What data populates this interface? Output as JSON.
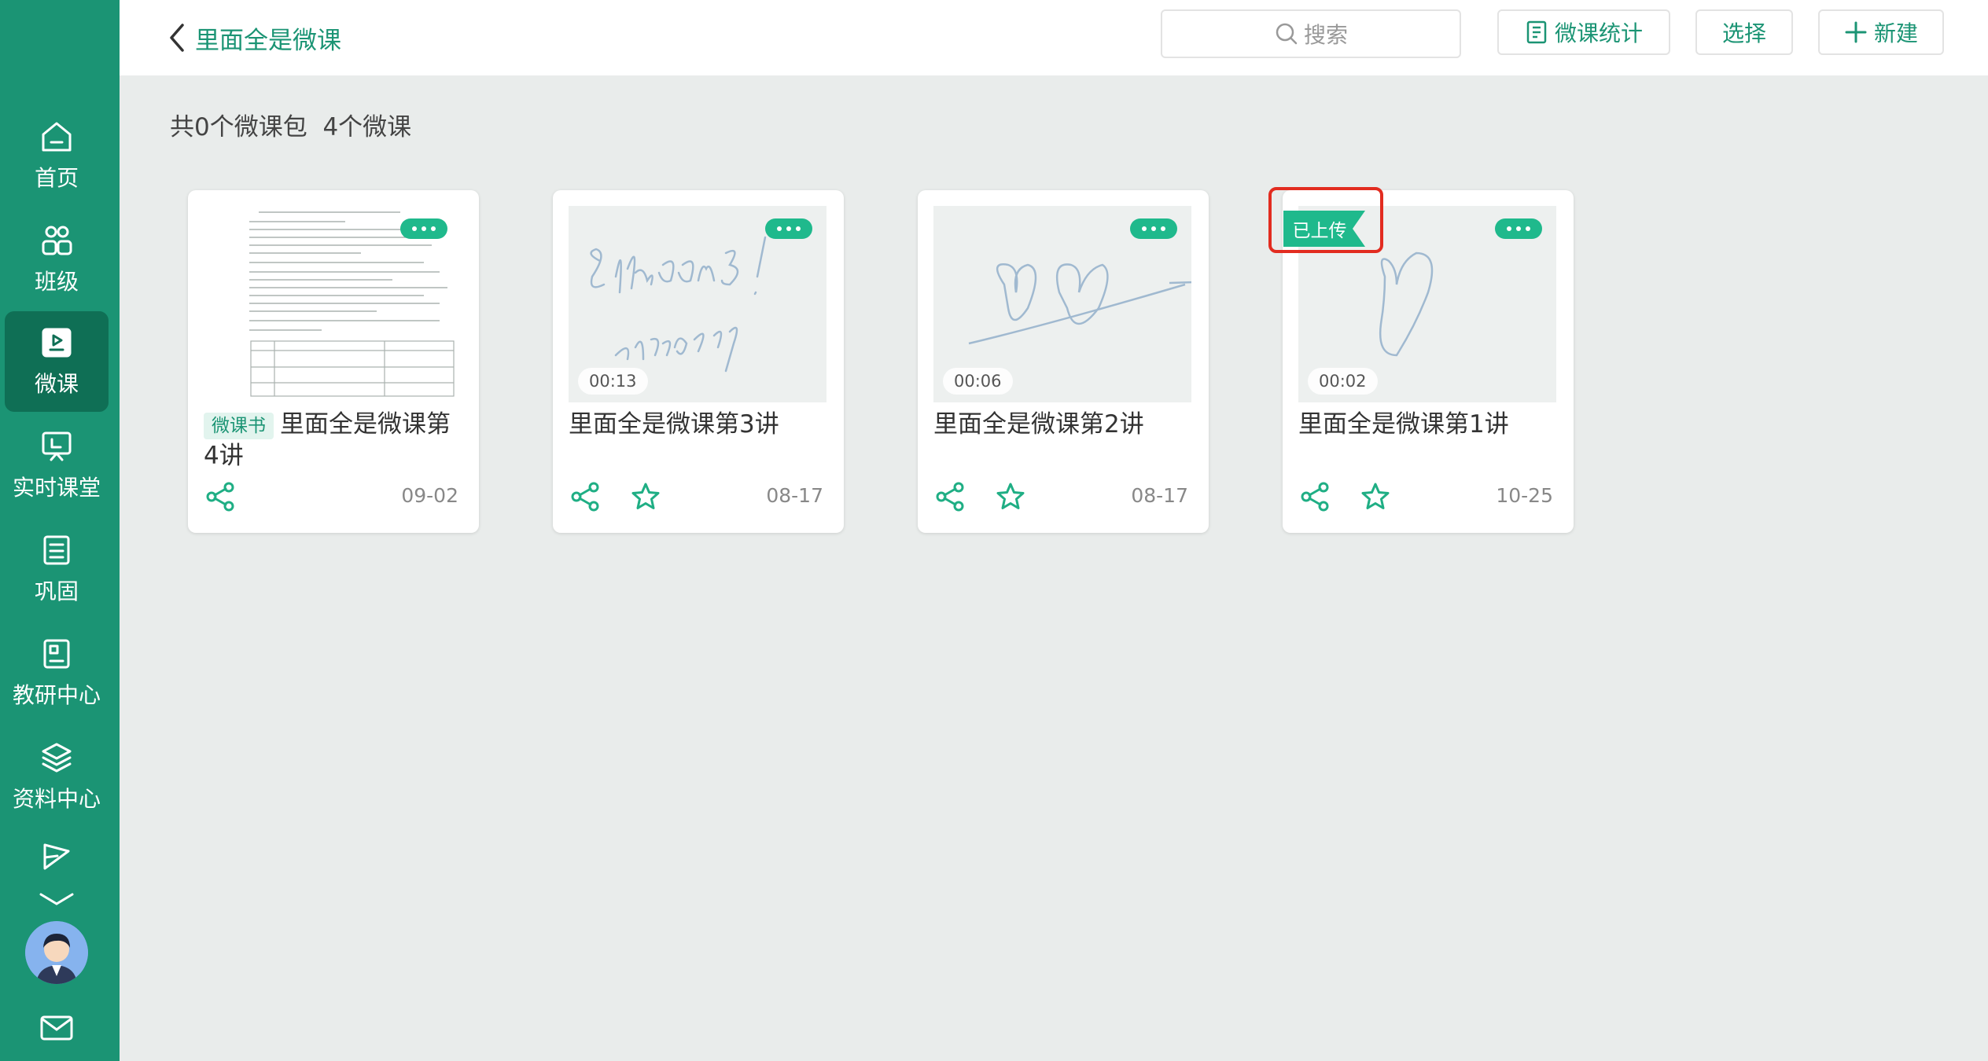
{
  "header": {
    "back_title": "里面全是微课",
    "search_placeholder": "搜索",
    "stats_label": "微课统计",
    "select_label": "选择",
    "new_label": "新建"
  },
  "summary": {
    "packages": "共0个微课包",
    "lessons": "4个微课"
  },
  "sidebar": {
    "items": [
      {
        "label": "首页",
        "icon": "home-icon"
      },
      {
        "label": "班级",
        "icon": "class-icon"
      },
      {
        "label": "微课",
        "icon": "micro-lesson-icon",
        "active": true
      },
      {
        "label": "实时课堂",
        "icon": "live-class-icon"
      },
      {
        "label": "巩固",
        "icon": "consolidate-icon"
      },
      {
        "label": "教研中心",
        "icon": "research-icon"
      },
      {
        "label": "资料中心",
        "icon": "materials-icon"
      }
    ],
    "more_icon": "send-icon",
    "expand_icon": "chevron-down-icon",
    "mail_icon": "mail-icon"
  },
  "cards": [
    {
      "tag": "微课书",
      "title": "里面全是微课第4讲",
      "duration": "",
      "date": "09-02",
      "has_star": false
    },
    {
      "tag": "",
      "title": "里面全是微课第3讲",
      "duration": "00:13",
      "date": "08-17",
      "has_star": true
    },
    {
      "tag": "",
      "title": "里面全是微课第2讲",
      "duration": "00:06",
      "date": "08-17",
      "has_star": true
    },
    {
      "tag": "",
      "title": "里面全是微课第1讲",
      "duration": "00:02",
      "date": "10-25",
      "has_star": true,
      "badge": "已上传"
    }
  ],
  "colors": {
    "primary": "#1b9474",
    "accent": "#1fb98c",
    "highlight": "#e22c20"
  }
}
